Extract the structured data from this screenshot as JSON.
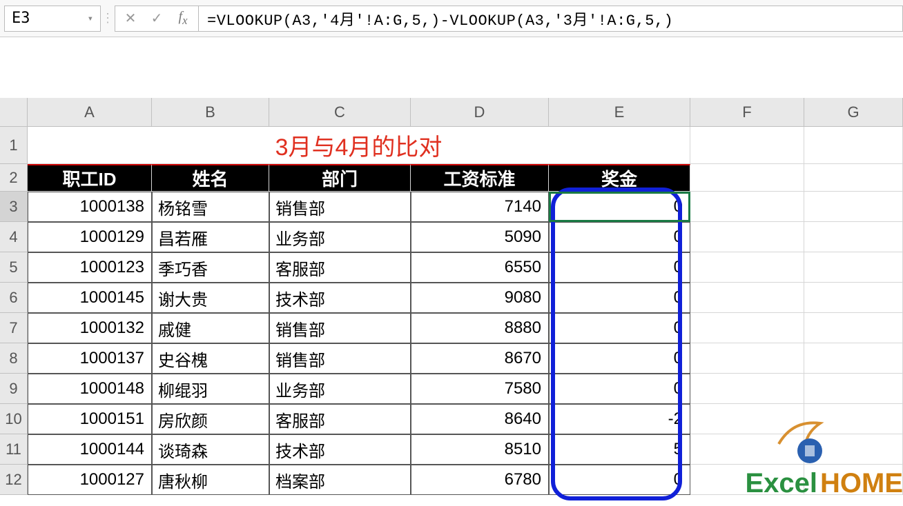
{
  "name_box": "E3",
  "formula": "=VLOOKUP(A3,'4月'!A:G,5,)-VLOOKUP(A3,'3月'!A:G,5,)",
  "col_headers": [
    "A",
    "B",
    "C",
    "D",
    "E",
    "F",
    "G"
  ],
  "row_headers": [
    "1",
    "2",
    "3",
    "4",
    "5",
    "6",
    "7",
    "8",
    "9",
    "10",
    "11",
    "12"
  ],
  "title": "3月与4月的比对",
  "table_headers": {
    "id": "职工ID",
    "name": "姓名",
    "dept": "部门",
    "salary": "工资标准",
    "bonus": "奖金"
  },
  "rows": [
    {
      "id": "1000138",
      "name": "杨铭雪",
      "dept": "销售部",
      "salary": "7140",
      "bonus": "0"
    },
    {
      "id": "1000129",
      "name": "昌若雁",
      "dept": "业务部",
      "salary": "5090",
      "bonus": "0"
    },
    {
      "id": "1000123",
      "name": "季巧香",
      "dept": "客服部",
      "salary": "6550",
      "bonus": "0"
    },
    {
      "id": "1000145",
      "name": "谢大贵",
      "dept": "技术部",
      "salary": "9080",
      "bonus": "0"
    },
    {
      "id": "1000132",
      "name": "戚健",
      "dept": "销售部",
      "salary": "8880",
      "bonus": "0"
    },
    {
      "id": "1000137",
      "name": "史谷槐",
      "dept": "销售部",
      "salary": "8670",
      "bonus": "0"
    },
    {
      "id": "1000148",
      "name": "柳绲羽",
      "dept": "业务部",
      "salary": "7580",
      "bonus": "0"
    },
    {
      "id": "1000151",
      "name": "房欣颜",
      "dept": "客服部",
      "salary": "8640",
      "bonus": "-2"
    },
    {
      "id": "1000144",
      "name": "谈琦森",
      "dept": "技术部",
      "salary": "8510",
      "bonus": "5"
    },
    {
      "id": "1000127",
      "name": "唐秋柳",
      "dept": "档案部",
      "salary": "6780",
      "bonus": "0"
    }
  ],
  "logo_text": {
    "excel": "Excel",
    "home": "HOME"
  },
  "chart_data": {
    "type": "table",
    "title": "3月与4月的比对",
    "columns": [
      "职工ID",
      "姓名",
      "部门",
      "工资标准",
      "奖金"
    ],
    "data": [
      [
        "1000138",
        "杨铭雪",
        "销售部",
        7140,
        0
      ],
      [
        "1000129",
        "昌若雁",
        "业务部",
        5090,
        0
      ],
      [
        "1000123",
        "季巧香",
        "客服部",
        6550,
        0
      ],
      [
        "1000145",
        "谢大贵",
        "技术部",
        9080,
        0
      ],
      [
        "1000132",
        "戚健",
        "销售部",
        8880,
        0
      ],
      [
        "1000137",
        "史谷槐",
        "销售部",
        8670,
        0
      ],
      [
        "1000148",
        "柳绲羽",
        "业务部",
        7580,
        0
      ],
      [
        "1000151",
        "房欣颜",
        "客服部",
        8640,
        -2
      ],
      [
        "1000144",
        "谈琦森",
        "技术部",
        8510,
        5
      ],
      [
        "1000127",
        "唐秋柳",
        "档案部",
        6780,
        0
      ]
    ]
  }
}
